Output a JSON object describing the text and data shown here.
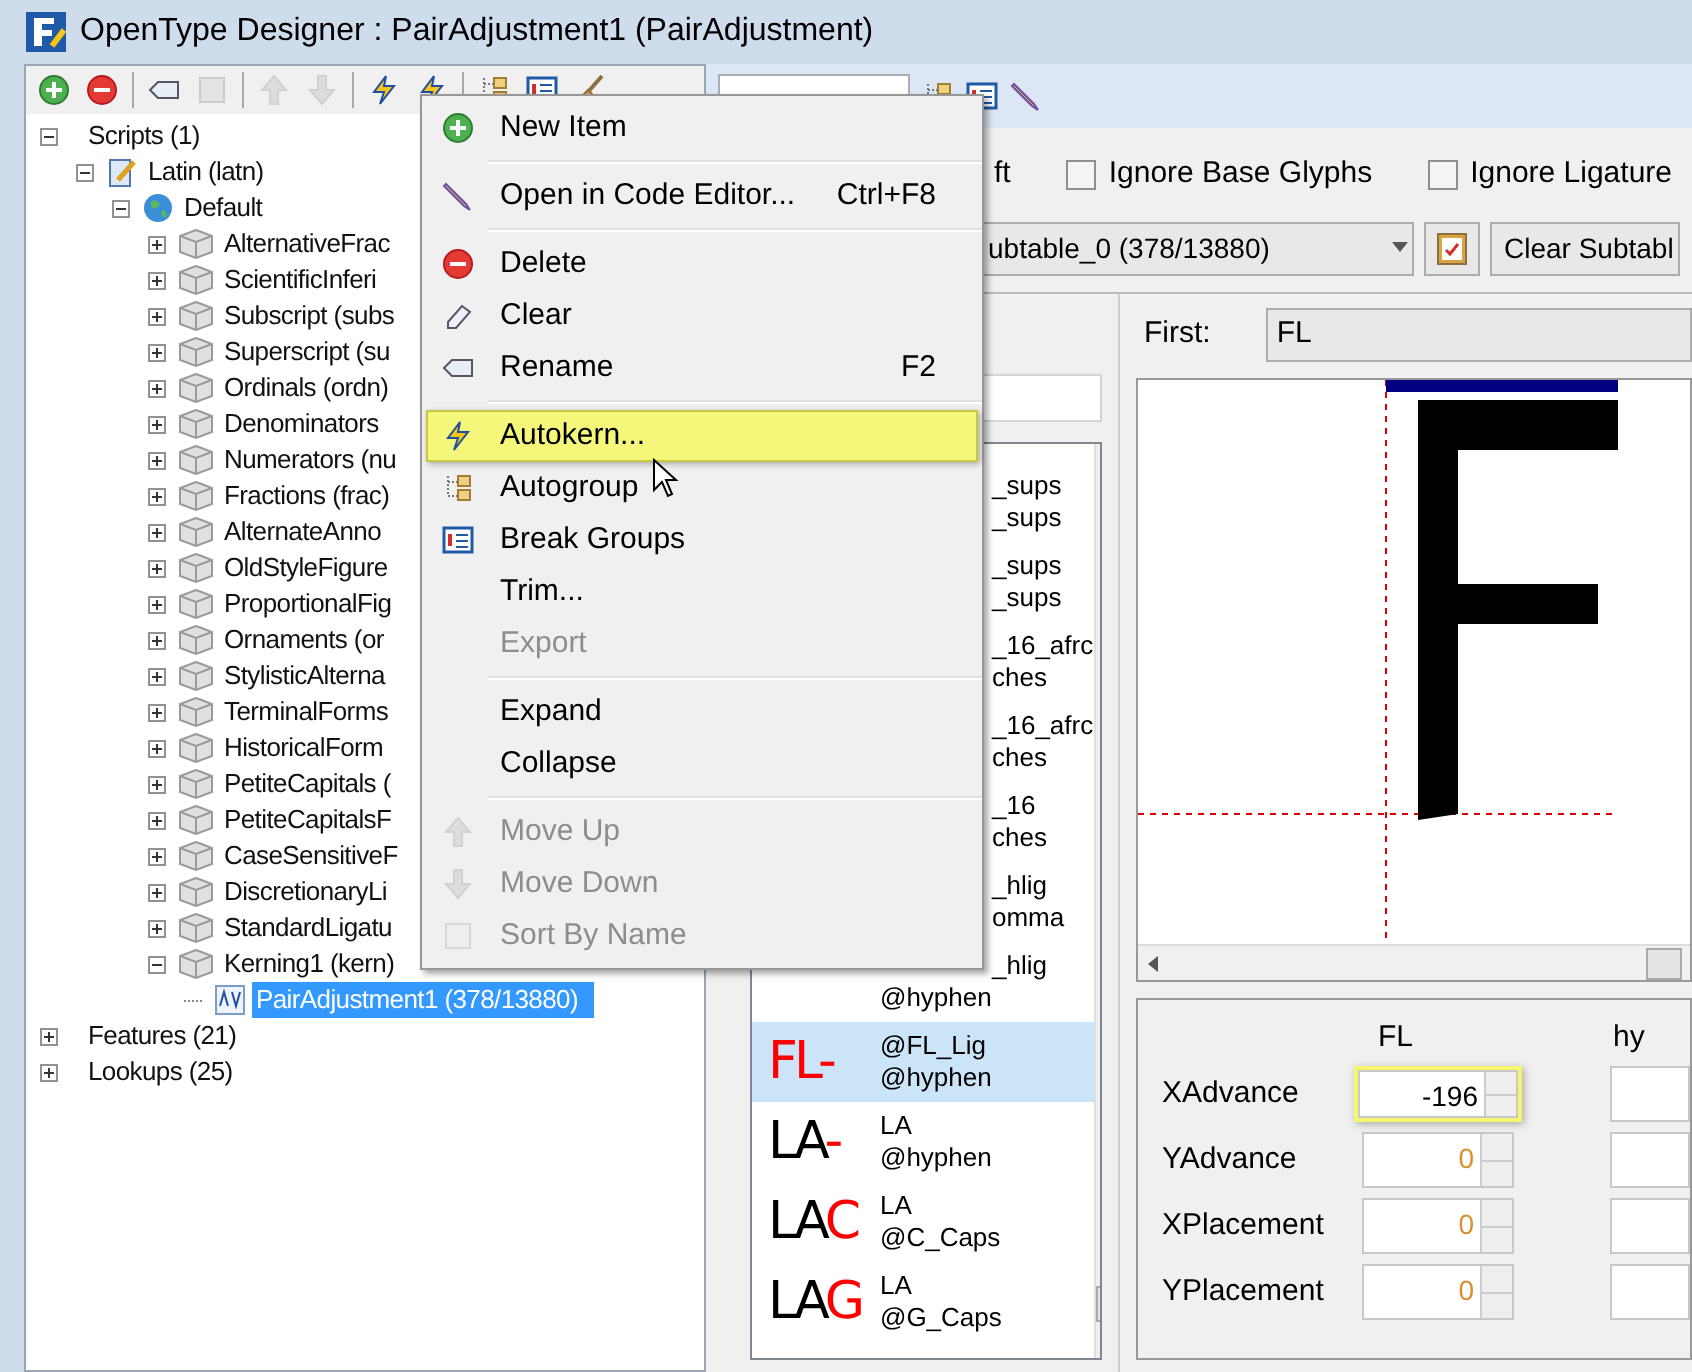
{
  "window": {
    "title": "OpenType Designer : PairAdjustment1 (PairAdjustment)"
  },
  "left_toolbar": [
    {
      "kind": "add",
      "disabled": false
    },
    {
      "kind": "remove",
      "disabled": false
    },
    {
      "kind": "separator"
    },
    {
      "kind": "rename",
      "disabled": false
    },
    {
      "kind": "xyz",
      "disabled": true
    },
    {
      "kind": "separator"
    },
    {
      "kind": "up",
      "disabled": true
    },
    {
      "kind": "down",
      "disabled": true
    },
    {
      "kind": "separator"
    },
    {
      "kind": "autokern",
      "disabled": false
    },
    {
      "kind": "autokern",
      "disabled": false
    },
    {
      "kind": "separator"
    },
    {
      "kind": "autogroup",
      "disabled": false
    },
    {
      "kind": "breakgroups",
      "disabled": false
    },
    {
      "kind": "brush",
      "disabled": false
    }
  ],
  "tree": [
    {
      "label": "Scripts (1)",
      "kind": "folder",
      "expanded": true,
      "selected": false,
      "children": [
        {
          "label": "Latin (latn)",
          "kind": "script",
          "expanded": true,
          "selected": false,
          "children": [
            {
              "label": "Default",
              "kind": "language",
              "expanded": true,
              "selected": false,
              "children": [
                {
                  "label": "AlternativeFrac",
                  "kind": "feature",
                  "expanded": false,
                  "selected": false
                },
                {
                  "label": "ScientificInferi",
                  "kind": "feature",
                  "expanded": false,
                  "selected": false
                },
                {
                  "label": "Subscript (subs",
                  "kind": "feature",
                  "expanded": false,
                  "selected": false
                },
                {
                  "label": "Superscript (su",
                  "kind": "feature",
                  "expanded": false,
                  "selected": false
                },
                {
                  "label": "Ordinals (ordn)",
                  "kind": "feature",
                  "expanded": false,
                  "selected": false
                },
                {
                  "label": "Denominators",
                  "kind": "feature",
                  "expanded": false,
                  "selected": false
                },
                {
                  "label": "Numerators (nu",
                  "kind": "feature",
                  "expanded": false,
                  "selected": false
                },
                {
                  "label": "Fractions (frac)",
                  "kind": "feature",
                  "expanded": false,
                  "selected": false
                },
                {
                  "label": "AlternateAnno",
                  "kind": "feature",
                  "expanded": false,
                  "selected": false
                },
                {
                  "label": "OldStyleFigure",
                  "kind": "feature",
                  "expanded": false,
                  "selected": false
                },
                {
                  "label": "ProportionalFig",
                  "kind": "feature",
                  "expanded": false,
                  "selected": false
                },
                {
                  "label": "Ornaments (or",
                  "kind": "feature",
                  "expanded": false,
                  "selected": false
                },
                {
                  "label": "StylisticAlterna",
                  "kind": "feature",
                  "expanded": false,
                  "selected": false
                },
                {
                  "label": "TerminalForms",
                  "kind": "feature",
                  "expanded": false,
                  "selected": false
                },
                {
                  "label": "HistoricalForm",
                  "kind": "feature",
                  "expanded": false,
                  "selected": false
                },
                {
                  "label": "PetiteCapitals (",
                  "kind": "feature",
                  "expanded": false,
                  "selected": false
                },
                {
                  "label": "PetiteCapitalsF",
                  "kind": "feature",
                  "expanded": false,
                  "selected": false
                },
                {
                  "label": "CaseSensitiveF",
                  "kind": "feature",
                  "expanded": false,
                  "selected": false
                },
                {
                  "label": "DiscretionaryLi",
                  "kind": "feature",
                  "expanded": false,
                  "selected": false
                },
                {
                  "label": "StandardLigatu",
                  "kind": "feature",
                  "expanded": false,
                  "selected": false
                },
                {
                  "label": "Kerning1 (kern)",
                  "kind": "feature",
                  "expanded": true,
                  "selected": false,
                  "children": [
                    {
                      "label": "PairAdjustment1 (378/13880)",
                      "kind": "lookup",
                      "selected": true
                    }
                  ]
                }
              ]
            }
          ]
        }
      ]
    },
    {
      "label": "Features (21)",
      "kind": "folder",
      "expanded": false,
      "selected": false
    },
    {
      "label": "Lookups (25)",
      "kind": "folder",
      "expanded": false,
      "selected": false
    }
  ],
  "options": {
    "direction_fragment": "ft",
    "checkboxes": [
      {
        "label": "Ignore Base Glyphs",
        "checked": false
      },
      {
        "label": "Ignore Ligature",
        "checked": false
      }
    ]
  },
  "subtable": {
    "value": "ubtable_0 (378/13880)",
    "clear_button": "Clear Subtabl"
  },
  "pairs": [
    {
      "kind": "partial",
      "line1": "_sups",
      "line2": "_sups",
      "selected": false
    },
    {
      "kind": "partial",
      "line1": "_sups",
      "line2": "_sups",
      "selected": false
    },
    {
      "kind": "partial",
      "line1": "_16_afrc",
      "line2": "ches",
      "selected": false
    },
    {
      "kind": "partial",
      "line1": "_16_afrc",
      "line2": "ches",
      "selected": false
    },
    {
      "kind": "partial",
      "line1": "_16",
      "line2": "ches",
      "selected": false
    },
    {
      "kind": "partial",
      "line1": "_hlig",
      "line2": "omma",
      "selected": false
    },
    {
      "kind": "half",
      "line1": "_hlig",
      "line2": "@hyphen",
      "selected": false
    },
    {
      "kind": "full",
      "line1": "@FL_Lig",
      "line2": "@hyphen",
      "selected": true,
      "preview": [
        {
          "text": "FL",
          "color": "#ff0000"
        },
        {
          "text": "-",
          "color": "#ff0000"
        }
      ]
    },
    {
      "kind": "full",
      "line1": "LA",
      "line2": "@hyphen",
      "selected": false,
      "preview": [
        {
          "text": "LA",
          "color": "#000000"
        },
        {
          "text": "-",
          "color": "#ff0000"
        }
      ]
    },
    {
      "kind": "full",
      "line1": "LA",
      "line2": "@C_Caps",
      "selected": false,
      "preview": [
        {
          "text": "LA",
          "color": "#000000"
        },
        {
          "text": "C",
          "color": "#ff0000"
        }
      ]
    },
    {
      "kind": "full",
      "line1": "LA",
      "line2": "@G_Caps",
      "selected": false,
      "preview": [
        {
          "text": "LA",
          "color": "#000000"
        },
        {
          "text": "G",
          "color": "#ff0000"
        }
      ]
    }
  ],
  "first": {
    "label": "First:",
    "value": "FL"
  },
  "values": {
    "columns": [
      "FL",
      "hy"
    ],
    "rows": [
      {
        "label": "XAdvance",
        "value": "-196",
        "highlighted": true,
        "default": false
      },
      {
        "label": "YAdvance",
        "value": "0",
        "highlighted": false,
        "default": true
      },
      {
        "label": "XPlacement",
        "value": "0",
        "highlighted": false,
        "default": true
      },
      {
        "label": "YPlacement",
        "value": "0",
        "highlighted": false,
        "default": true
      }
    ]
  },
  "context_menu": [
    {
      "kind": "add",
      "label": "New Item",
      "disabled": false,
      "selected": false
    },
    {
      "kind": "separator"
    },
    {
      "kind": "pencil",
      "label": "Open in Code Editor...",
      "shortcut": "Ctrl+F8",
      "disabled": false,
      "selected": false
    },
    {
      "kind": "separator"
    },
    {
      "kind": "remove",
      "label": "Delete",
      "disabled": false,
      "selected": false
    },
    {
      "kind": "eraser",
      "label": "Clear",
      "disabled": false,
      "selected": false
    },
    {
      "kind": "tag",
      "label": "Rename",
      "shortcut": "F2",
      "disabled": false,
      "selected": false
    },
    {
      "kind": "separator"
    },
    {
      "kind": "autokern",
      "label": "Autokern...",
      "disabled": false,
      "selected": true
    },
    {
      "kind": "autogroup",
      "label": "Autogroup",
      "disabled": false,
      "selected": false
    },
    {
      "kind": "list",
      "label": "Break Groups",
      "disabled": false,
      "selected": false
    },
    {
      "kind": "text",
      "label": "Trim...",
      "disabled": false,
      "selected": false
    },
    {
      "kind": "text",
      "label": "Export",
      "disabled": true,
      "selected": false
    },
    {
      "kind": "separator"
    },
    {
      "kind": "text",
      "label": "Expand",
      "disabled": false,
      "selected": false
    },
    {
      "kind": "text",
      "label": "Collapse",
      "disabled": false,
      "selected": false
    },
    {
      "kind": "separator"
    },
    {
      "kind": "up",
      "label": "Move Up",
      "disabled": true,
      "selected": false
    },
    {
      "kind": "down",
      "label": "Move Down",
      "disabled": true,
      "selected": false
    },
    {
      "kind": "sort",
      "label": "Sort By Name",
      "disabled": true,
      "selected": false
    }
  ]
}
